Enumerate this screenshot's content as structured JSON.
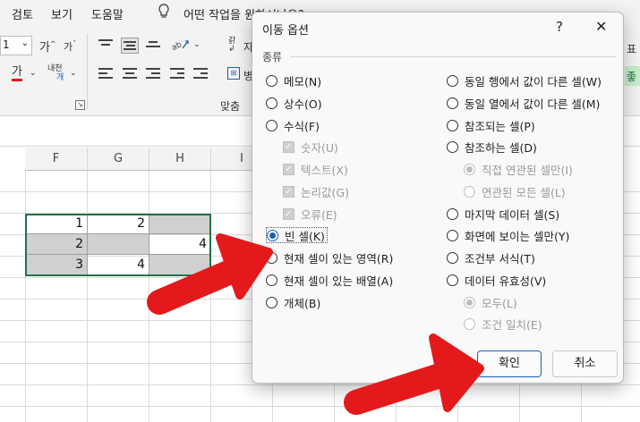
{
  "menu": {
    "items": [
      "검토",
      "보기",
      "도움말"
    ],
    "tell_me": "어떤 작업을 원하시나요?"
  },
  "ribbon": {
    "font_size": "1",
    "grow_font": "가",
    "shrink_font": "가",
    "font_color_label": "가",
    "phonetic_label": "내천",
    "phonetic_sub": "개",
    "wrap_label": "갉",
    "wrap_text": "자",
    "merge_text": "병",
    "alignment_group": "맞춤",
    "right_edge_top": "표",
    "right_edge_mid": "좋"
  },
  "sheet": {
    "columns": [
      "F",
      "G",
      "H",
      "I"
    ],
    "cells": [
      {
        "row": 1,
        "col": "F",
        "value": "1"
      },
      {
        "row": 1,
        "col": "G",
        "value": "2"
      },
      {
        "row": 2,
        "col": "F",
        "value": "2"
      },
      {
        "row": 2,
        "col": "H",
        "value": "4"
      },
      {
        "row": 3,
        "col": "F",
        "value": "3"
      },
      {
        "row": 3,
        "col": "G",
        "value": "4"
      }
    ]
  },
  "dialog": {
    "title": "이동 옵션",
    "help": "?",
    "close": "✕",
    "section_label": "종류",
    "left_options": [
      {
        "label": "메모(N)",
        "type": "radio",
        "checked": false,
        "disabled": false
      },
      {
        "label": "상수(O)",
        "type": "radio",
        "checked": false,
        "disabled": false
      },
      {
        "label": "수식(F)",
        "type": "radio",
        "checked": false,
        "disabled": false
      },
      {
        "label": "숫자(U)",
        "type": "checkbox",
        "checked": true,
        "disabled": true
      },
      {
        "label": "텍스트(X)",
        "type": "checkbox",
        "checked": true,
        "disabled": true
      },
      {
        "label": "논리값(G)",
        "type": "checkbox",
        "checked": true,
        "disabled": true
      },
      {
        "label": "오류(E)",
        "type": "checkbox",
        "checked": true,
        "disabled": true
      },
      {
        "label": "빈 셀(K)",
        "type": "radio",
        "checked": true,
        "disabled": false
      },
      {
        "label": "현재 셀이 있는 영역(R)",
        "type": "radio",
        "checked": false,
        "disabled": false
      },
      {
        "label": "현재 셀이 있는 배열(A)",
        "type": "radio",
        "checked": false,
        "disabled": false
      },
      {
        "label": "개체(B)",
        "type": "radio",
        "checked": false,
        "disabled": false
      }
    ],
    "right_options": [
      {
        "label": "동일 행에서 값이 다른 셀(W)",
        "type": "radio",
        "checked": false,
        "disabled": false
      },
      {
        "label": "동일 열에서 값이 다른 셀(M)",
        "type": "radio",
        "checked": false,
        "disabled": false
      },
      {
        "label": "참조되는 셀(P)",
        "type": "radio",
        "checked": false,
        "disabled": false
      },
      {
        "label": "참조하는 셀(D)",
        "type": "radio",
        "checked": false,
        "disabled": false
      },
      {
        "label": "직접 연관된 셀만(I)",
        "type": "radio",
        "checked": true,
        "disabled": true
      },
      {
        "label": "연관된 모든 셀(L)",
        "type": "radio",
        "checked": false,
        "disabled": true
      },
      {
        "label": "마지막 데이터 셀(S)",
        "type": "radio",
        "checked": false,
        "disabled": false
      },
      {
        "label": "화면에 보이는 셀만(Y)",
        "type": "radio",
        "checked": false,
        "disabled": false
      },
      {
        "label": "조건부 서식(T)",
        "type": "radio",
        "checked": false,
        "disabled": false
      },
      {
        "label": "데이터 유효성(V)",
        "type": "radio",
        "checked": false,
        "disabled": false
      },
      {
        "label": "모두(L)",
        "type": "radio",
        "checked": true,
        "disabled": true
      },
      {
        "label": "조건 일치(E)",
        "type": "radio",
        "checked": false,
        "disabled": true
      }
    ],
    "ok_label": "확인",
    "cancel_label": "취소"
  },
  "colors": {
    "accent": "#1a5fb4",
    "excel_green": "#217346",
    "arrow_red": "#e3191c"
  }
}
